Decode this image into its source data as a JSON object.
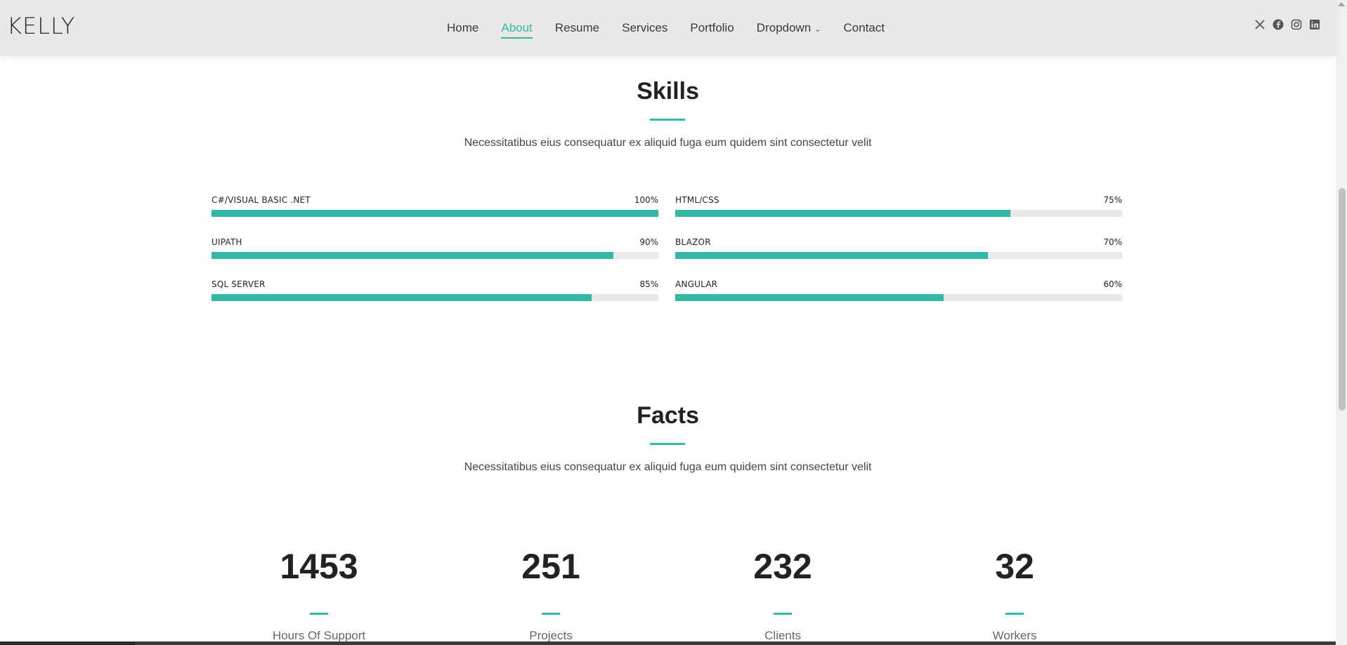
{
  "header": {
    "logo": "KELLY",
    "nav": [
      {
        "label": "Home",
        "active": false
      },
      {
        "label": "About",
        "active": true
      },
      {
        "label": "Resume",
        "active": false
      },
      {
        "label": "Services",
        "active": false
      },
      {
        "label": "Portfolio",
        "active": false
      },
      {
        "label": "Dropdown",
        "active": false,
        "has_dropdown": true
      },
      {
        "label": "Contact",
        "active": false
      }
    ],
    "socials": [
      "x-twitter-icon",
      "facebook-icon",
      "instagram-icon",
      "linkedin-icon"
    ]
  },
  "skills": {
    "title": "Skills",
    "subtitle": "Necessitatibus eius consequatur ex aliquid fuga eum quidem sint consectetur velit",
    "items": [
      {
        "name": "C#/VISUAL BASIC .NET",
        "value": "100%",
        "percent": 100
      },
      {
        "name": "HTML/CSS",
        "value": "75%",
        "percent": 75
      },
      {
        "name": "UIPATH",
        "value": "90%",
        "percent": 90
      },
      {
        "name": "BLAZOR",
        "value": "70%",
        "percent": 70
      },
      {
        "name": "SQL SERVER",
        "value": "85%",
        "percent": 85
      },
      {
        "name": "ANGULAR",
        "value": "60%",
        "percent": 60
      }
    ]
  },
  "facts": {
    "title": "Facts",
    "subtitle": "Necessitatibus eius consequatur ex aliquid fuga eum quidem sint consectetur velit",
    "items": [
      {
        "number": "1453",
        "label": "Hours Of Support"
      },
      {
        "number": "251",
        "label": "Projects"
      },
      {
        "number": "232",
        "label": "Clients"
      },
      {
        "number": "32",
        "label": "Workers"
      }
    ]
  },
  "colors": {
    "accent": "#34b7a7",
    "header_bg": "#e9e8e6",
    "bar_track": "#e9e9e9"
  }
}
